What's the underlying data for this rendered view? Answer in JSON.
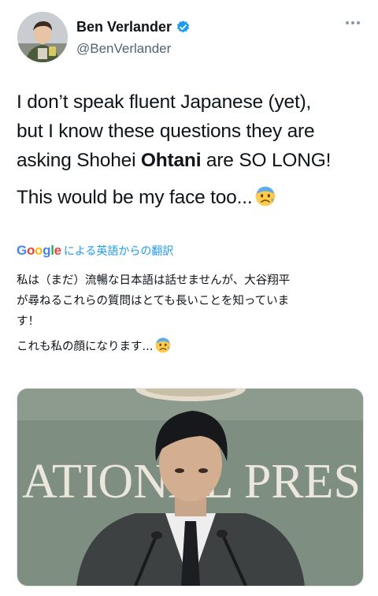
{
  "author": {
    "display_name": "Ben Verlander",
    "handle": "@BenVerlander"
  },
  "tweet": {
    "line1": "I don’t speak fluent Japanese (yet),",
    "line2": "but I know these questions they are",
    "line3_before": "asking Shohei ",
    "line3_bold": "Ohtani",
    "line3_after": " are SO LONG!",
    "line4": "This would be my face too..."
  },
  "translation": {
    "google_letters": [
      "G",
      "o",
      "o",
      "g",
      "l",
      "e"
    ],
    "google_colors": [
      "#4285F4",
      "#EA4335",
      "#FBBC05",
      "#4285F4",
      "#34A853",
      "#EA4335"
    ],
    "label": "による英語からの翻訳",
    "line1": "私は（まだ）流暢な日本語は話せませんが、大谷翔平",
    "line2": "が尋ねるこれらの質問はとても長いことを知っていま",
    "line3": "す！",
    "line4": "これも私の顔になります..."
  },
  "media": {
    "backdrop_text": "ATIONAL PRES"
  },
  "icons": {
    "verified": "verified-badge-icon",
    "more": "more-options-icon",
    "emoji": "anxious-face-emoji"
  },
  "colors": {
    "accent": "#1d9bf0",
    "text": "#0f1419",
    "secondary": "#536471"
  }
}
